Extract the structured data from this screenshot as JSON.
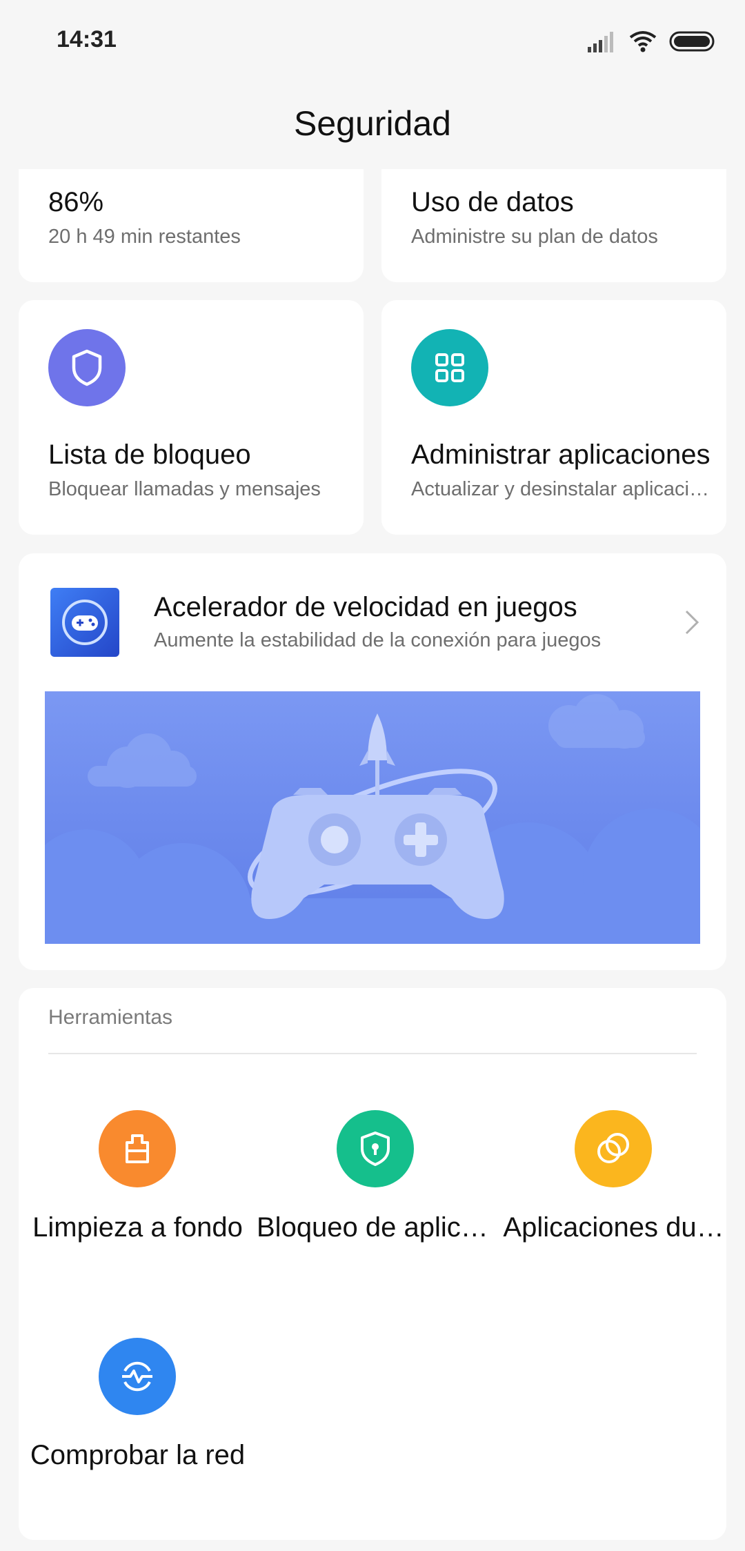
{
  "status_bar": {
    "time": "14:31",
    "icons": [
      "signal-icon",
      "wifi-icon",
      "battery-icon"
    ]
  },
  "header": {
    "title": "Seguridad"
  },
  "cards": {
    "battery": {
      "title": "86%",
      "subtitle": "20 h 49 min  restantes"
    },
    "data_usage": {
      "title": "Uso de datos",
      "subtitle": "Administre su plan de datos"
    },
    "blocklist": {
      "title": "Lista de bloqueo",
      "subtitle": "Bloquear llamadas y mensajes",
      "icon": "shield-icon",
      "color": "#6f74ea"
    },
    "manage_apps": {
      "title": "Administrar aplicaciones",
      "subtitle": "Actualizar y desinstalar aplicacio…",
      "icon": "apps-grid-icon",
      "color": "#12b3b4"
    }
  },
  "game_booster": {
    "title": "Acelerador de velocidad en juegos",
    "subtitle": "Aumente la estabilidad de la conexión para juegos",
    "icon": "gamepad-icon",
    "banner_color": "#6d8ef0"
  },
  "tools": {
    "header": "Herramientas",
    "items": [
      {
        "label": "Limpieza a fondo",
        "icon": "deep-clean-icon",
        "color": "#f98a2e"
      },
      {
        "label": "Bloqueo de aplica…",
        "icon": "app-lock-icon",
        "color": "#15bf8c"
      },
      {
        "label": "Aplicaciones du…",
        "icon": "dual-apps-icon",
        "color": "#fbb61e"
      },
      {
        "label": "Comprobar la red",
        "icon": "network-check-icon",
        "color": "#2f86f0"
      }
    ]
  }
}
